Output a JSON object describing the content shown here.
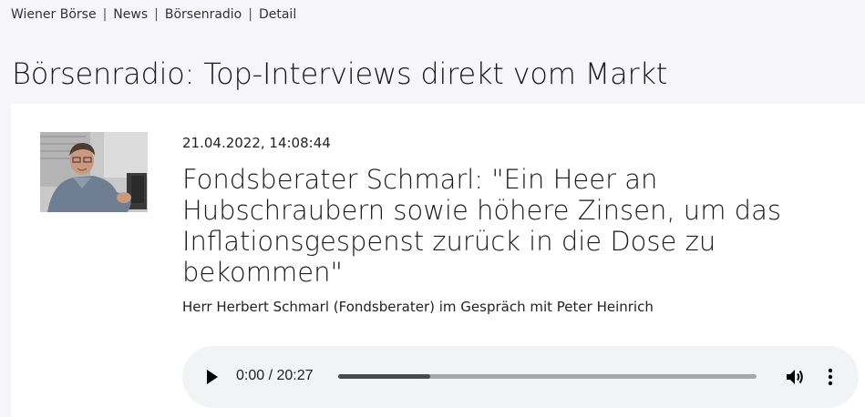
{
  "breadcrumb": {
    "items": [
      {
        "label": "Wiener Börse"
      },
      {
        "label": "News"
      },
      {
        "label": "Börsenradio"
      },
      {
        "label": "Detail"
      }
    ],
    "separator": "|"
  },
  "page": {
    "title": "Börsenradio: Top-Interviews direkt vom Markt"
  },
  "article": {
    "date": "21.04.2022, 14:08:44",
    "headline": "Fondsberater Schmarl: \"Ein Heer an Hubschraubern sowie höhere Zinsen, um das Inflationsgespenst zurück in die Dose zu bekommen\"",
    "subtitle": "Herr Herbert Schmarl (Fondsberater) im Gespräch mit Peter Heinrich",
    "thumbnail_icon": "portrait-photo"
  },
  "player": {
    "time": "0:00 / 20:27",
    "buffered_fraction": 0.22,
    "play_icon": "play-icon",
    "volume_icon": "volume-icon",
    "more_icon": "more-vertical-icon"
  },
  "colors": {
    "background": "#f6f6f8",
    "card": "#ffffff",
    "player_bg": "#f1f3f4",
    "text": "#222222"
  }
}
